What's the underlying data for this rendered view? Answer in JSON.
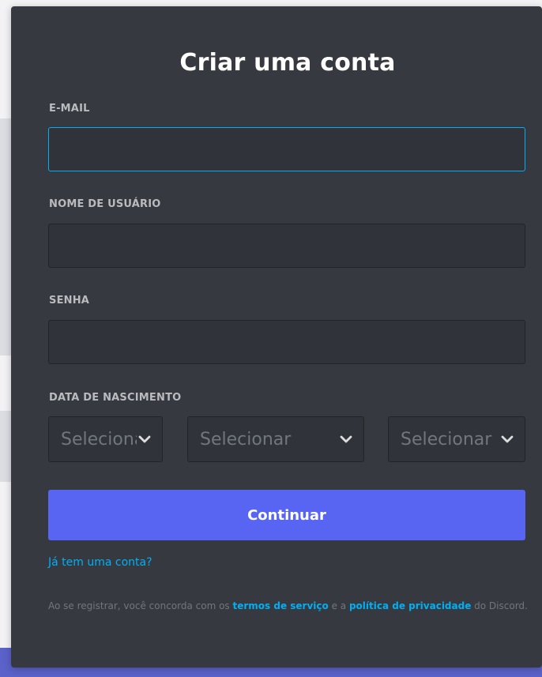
{
  "form": {
    "title": "Criar uma conta",
    "email": {
      "label": "E-MAIL",
      "value": ""
    },
    "username": {
      "label": "NOME DE USUÁRIO",
      "value": ""
    },
    "password": {
      "label": "SENHA",
      "value": ""
    },
    "birthdate": {
      "label": "DATA DE NASCIMENTO",
      "day": {
        "selected": "Selecionar"
      },
      "month": {
        "selected": "Selecionar"
      },
      "year": {
        "selected": "Selecionar"
      }
    },
    "continue_label": "Continuar",
    "login_link": "Já tem uma conta?",
    "terms": {
      "prefix": "Ao se registrar, você concorda com os ",
      "tos_link": "termos de serviço",
      "middle": " e a ",
      "privacy_link": "política de privacidade",
      "suffix": " do Discord."
    }
  },
  "icons": {
    "select_chevron": "chevron-down-icon"
  },
  "colors": {
    "card_bg": "#36393f",
    "input_bg": "#303339",
    "focus_border": "#00b0f4",
    "button": "#5865f2",
    "link": "#00b0f4",
    "label": "#b9bbbe",
    "muted": "#72767d"
  }
}
